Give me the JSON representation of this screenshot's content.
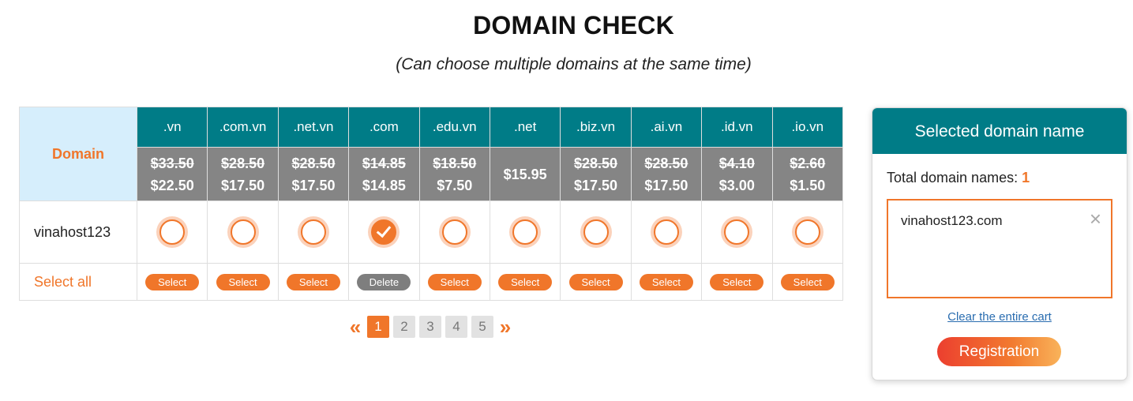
{
  "header": {
    "title": "DOMAIN CHECK",
    "subtitle": "(Can choose multiple domains at the same time)"
  },
  "table": {
    "domain_label": "Domain",
    "extensions": [
      {
        "ext": ".vn",
        "old_price": "$33.50",
        "price": "$22.50",
        "selected": false,
        "action": "Select"
      },
      {
        "ext": ".com.vn",
        "old_price": "$28.50",
        "price": "$17.50",
        "selected": false,
        "action": "Select"
      },
      {
        "ext": ".net.vn",
        "old_price": "$28.50",
        "price": "$17.50",
        "selected": false,
        "action": "Select"
      },
      {
        "ext": ".com",
        "old_price": "$14.85",
        "price": "$14.85",
        "selected": true,
        "action": "Delete"
      },
      {
        "ext": ".edu.vn",
        "old_price": "$18.50",
        "price": "$7.50",
        "selected": false,
        "action": "Select"
      },
      {
        "ext": ".net",
        "old_price": "",
        "price": "$15.95",
        "selected": false,
        "action": "Select"
      },
      {
        "ext": ".biz.vn",
        "old_price": "$28.50",
        "price": "$17.50",
        "selected": false,
        "action": "Select"
      },
      {
        "ext": ".ai.vn",
        "old_price": "$28.50",
        "price": "$17.50",
        "selected": false,
        "action": "Select"
      },
      {
        "ext": ".id.vn",
        "old_price": "$4.10",
        "price": "$3.00",
        "selected": false,
        "action": "Select"
      },
      {
        "ext": ".io.vn",
        "old_price": "$2.60",
        "price": "$1.50",
        "selected": false,
        "action": "Select"
      }
    ],
    "domain_name": "vinahost123",
    "select_all_label": "Select all"
  },
  "pagination": {
    "prev": "«",
    "next": "»",
    "pages": [
      "1",
      "2",
      "3",
      "4",
      "5"
    ],
    "current": "1"
  },
  "cart": {
    "title": "Selected domain name",
    "total_label": "Total domain names:",
    "total_count": "1",
    "items": [
      "vinahost123.com"
    ],
    "remove_icon": "×",
    "clear_label": "Clear the entire cart",
    "register_label": "Registration"
  },
  "colors": {
    "accent": "#f0762a",
    "header_teal": "#007c87",
    "price_gray": "#858585",
    "domain_head_bg": "#d6eefc",
    "link_blue": "#2a6db0"
  }
}
